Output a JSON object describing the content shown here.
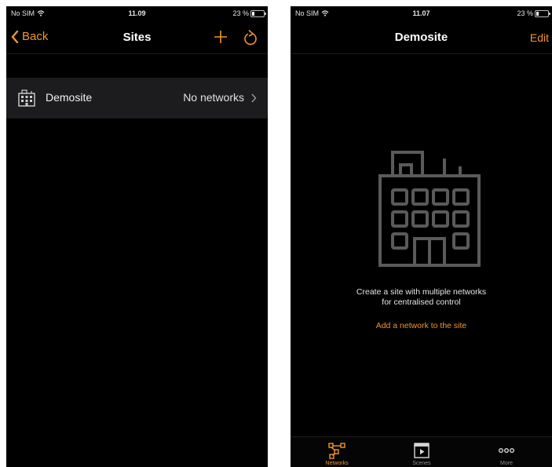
{
  "left_screen": {
    "status": {
      "carrier": "No SIM",
      "time": "11.09",
      "battery": "23 %"
    },
    "nav": {
      "back_label": "Back",
      "title": "Sites"
    },
    "icons": {
      "back": "chevron-left-icon",
      "add": "plus-icon",
      "refresh": "refresh-icon",
      "wifi": "wifi-icon",
      "battery": "battery-icon"
    },
    "sites": [
      {
        "name": "Demosite",
        "detail": "No networks",
        "icon": "building-icon"
      }
    ]
  },
  "right_screen": {
    "status": {
      "carrier": "No SIM",
      "time": "11.07",
      "battery": "23 %"
    },
    "nav": {
      "title": "Demosite",
      "edit_label": "Edit"
    },
    "empty_state": {
      "icon": "building-icon",
      "message": "Create a site with multiple networks\nfor centralised control",
      "action_label": "Add a network to the site"
    },
    "tabs": [
      {
        "label": "Networks",
        "icon": "network-icon",
        "active": true
      },
      {
        "label": "Scenes",
        "icon": "scenes-icon",
        "active": false
      },
      {
        "label": "More",
        "icon": "more-icon",
        "active": false
      }
    ]
  },
  "colors": {
    "accent": "#f0962d",
    "background": "#000000",
    "row_background": "#1c1c1e"
  }
}
